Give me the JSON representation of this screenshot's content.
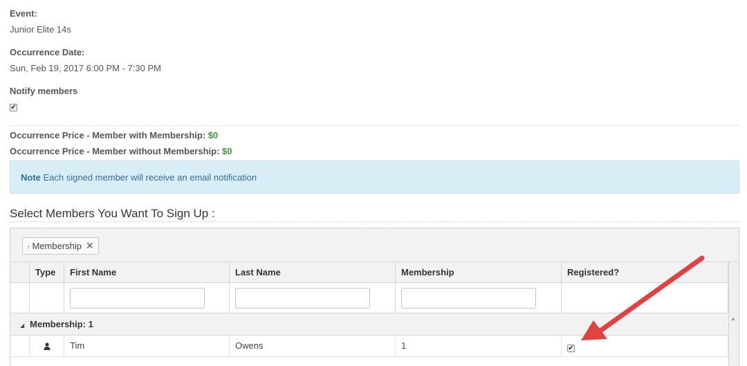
{
  "event": {
    "label": "Event:",
    "value": "Junior Elite 14s"
  },
  "occurrence_date": {
    "label": "Occurrence Date:",
    "value": "Sun, Feb 19, 2017 6:00 PM - 7:30 PM"
  },
  "notify": {
    "label": "Notify members",
    "checked": true
  },
  "prices": [
    {
      "label": "Occurrence Price - Member with Membership:",
      "value": "$0"
    },
    {
      "label": "Occurrence Price - Member without Membership:",
      "value": "$0"
    }
  ],
  "note": {
    "title": "Note",
    "text": "Each signed member will receive an email notification"
  },
  "section_title": "Select Members You Want To Sign Up :",
  "grid": {
    "group_chip": {
      "arrow": "↑",
      "label": "Membership",
      "remove": "✕"
    },
    "columns": [
      "",
      "Type",
      "First Name",
      "Last Name",
      "Membership",
      "Registered?"
    ],
    "group_row": {
      "label": "Membership: 1"
    },
    "rows": [
      {
        "type_icon": "person-icon",
        "first_name": "Tim",
        "last_name": "Owens",
        "membership": "1",
        "registered": true
      }
    ]
  },
  "colors": {
    "note_bg": "#d9edf7",
    "price_green": "#3c9a3c",
    "arrow_red": "#e04141"
  }
}
